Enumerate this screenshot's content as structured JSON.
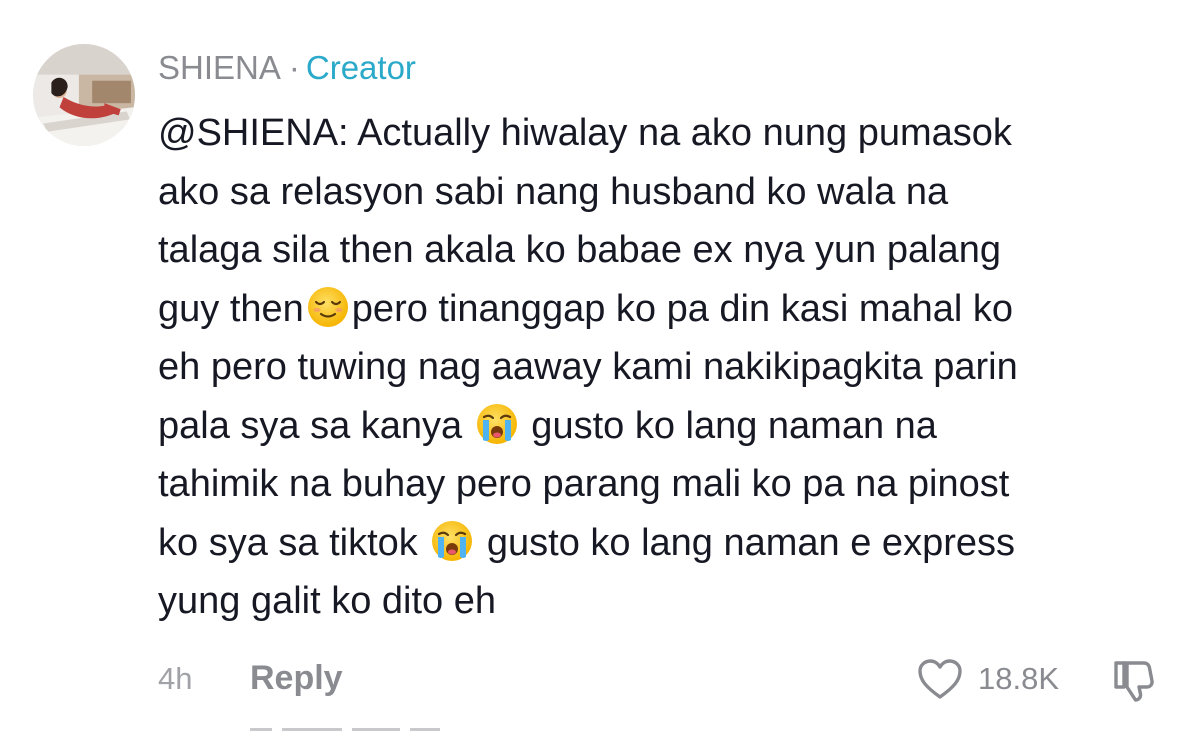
{
  "comment": {
    "username": "SHIENA",
    "separator": "·",
    "role_badge": "Creator",
    "lines": [
      "@SHIENA: Actually hiwalay na ako nung pumasok",
      "ako sa relasyon sabi nang husband ko wala na",
      "talaga sila then akala ko babae ex nya yun palang",
      "guy then",
      "pero tinanggap ko pa din kasi mahal ko",
      "eh pero tuwing nag aaway kami nakikipagkita parin",
      "pala sya sa kanya ",
      " gusto ko lang naman na",
      "tahimik na buhay pero parang mali ko pa na pinost",
      "ko sya sa tiktok ",
      " gusto ko lang naman e express",
      "yung galit ko dito eh"
    ],
    "emojis": {
      "relieved": "relieved-face-emoji",
      "crying": "loudly-crying-face-emoji"
    },
    "footer": {
      "time": "4h",
      "reply_label": "Reply",
      "like_count": "18.8K"
    },
    "icons": {
      "like": "heart-outline-icon",
      "dislike": "thumbs-down-icon"
    },
    "colors": {
      "username": "#8a8b91",
      "creator_badge": "#2aa9c9",
      "text": "#161823",
      "meta": "#a1a2a7"
    }
  }
}
